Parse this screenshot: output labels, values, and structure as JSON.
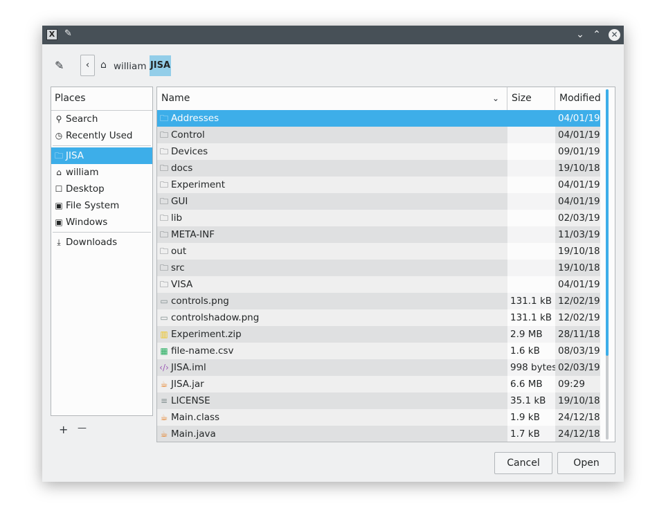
{
  "titlebar": {
    "app_icon": "kde-x-icon",
    "pin_icon": "pin-icon",
    "minimize_icon": "chevron-down-icon",
    "maximize_icon": "chevron-up-icon",
    "close_icon": "close-icon"
  },
  "nav": {
    "edit_icon": "pencil-icon",
    "back_icon": "chevron-left-icon",
    "home_icon": "home-icon",
    "crumbs": [
      "william",
      "JISA"
    ]
  },
  "places": {
    "header": "Places",
    "items": [
      {
        "label": "Search",
        "icon": "search-icon"
      },
      {
        "label": "Recently Used",
        "icon": "recent-icon"
      },
      {
        "label": "JISA",
        "icon": "folder-icon",
        "selected": true
      },
      {
        "label": "william",
        "icon": "home-icon"
      },
      {
        "label": "Desktop",
        "icon": "desktop-icon"
      },
      {
        "label": "File System",
        "icon": "drive-icon"
      },
      {
        "label": "Windows",
        "icon": "drive-icon"
      },
      {
        "label": "Downloads",
        "icon": "download-icon"
      }
    ],
    "add_label": "+",
    "remove_label": "—"
  },
  "files": {
    "columns": {
      "name": "Name",
      "size": "Size",
      "modified": "Modified"
    },
    "rows": [
      {
        "name": "Addresses",
        "size": "",
        "modified": "04/01/19",
        "icon": "folder-icon",
        "glyph": "🗀",
        "color": "#fcfcfc"
      },
      {
        "name": "Control",
        "size": "",
        "modified": "04/01/19",
        "icon": "folder-icon",
        "glyph": "🗀",
        "color": "#31363b"
      },
      {
        "name": "Devices",
        "size": "",
        "modified": "09/01/19",
        "icon": "folder-icon",
        "glyph": "🗀",
        "color": "#31363b"
      },
      {
        "name": "docs",
        "size": "",
        "modified": "19/10/18",
        "icon": "folder-icon",
        "glyph": "🗀",
        "color": "#31363b"
      },
      {
        "name": "Experiment",
        "size": "",
        "modified": "04/01/19",
        "icon": "folder-icon",
        "glyph": "🗀",
        "color": "#31363b"
      },
      {
        "name": "GUI",
        "size": "",
        "modified": "04/01/19",
        "icon": "folder-icon",
        "glyph": "🗀",
        "color": "#31363b"
      },
      {
        "name": "lib",
        "size": "",
        "modified": "02/03/19",
        "icon": "folder-icon",
        "glyph": "🗀",
        "color": "#31363b"
      },
      {
        "name": "META-INF",
        "size": "",
        "modified": "11/03/19",
        "icon": "folder-icon",
        "glyph": "🗀",
        "color": "#31363b"
      },
      {
        "name": "out",
        "size": "",
        "modified": "19/10/18",
        "icon": "folder-icon",
        "glyph": "🗀",
        "color": "#31363b"
      },
      {
        "name": "src",
        "size": "",
        "modified": "19/10/18",
        "icon": "folder-icon",
        "glyph": "🗀",
        "color": "#31363b"
      },
      {
        "name": "VISA",
        "size": "",
        "modified": "04/01/19",
        "icon": "folder-icon",
        "glyph": "🗀",
        "color": "#31363b"
      },
      {
        "name": "controls.png",
        "size": "131.1 kB",
        "modified": "12/02/19",
        "icon": "image-file-icon",
        "glyph": "▭",
        "color": "#7f8c8d"
      },
      {
        "name": "controlshadow.png",
        "size": "131.1 kB",
        "modified": "12/02/19",
        "icon": "image-file-icon",
        "glyph": "▭",
        "color": "#7f8c8d"
      },
      {
        "name": "Experiment.zip",
        "size": "2.9 MB",
        "modified": "28/11/18",
        "icon": "archive-icon",
        "glyph": "▥",
        "color": "#f0c419"
      },
      {
        "name": "file-name.csv",
        "size": "1.6 kB",
        "modified": "08/03/19",
        "icon": "spreadsheet-icon",
        "glyph": "▦",
        "color": "#27ae60"
      },
      {
        "name": "JISA.iml",
        "size": "998 bytes",
        "modified": "02/03/19",
        "icon": "code-file-icon",
        "glyph": "‹/›",
        "color": "#9b59b6"
      },
      {
        "name": "JISA.jar",
        "size": "6.6 MB",
        "modified": "09:29",
        "icon": "java-icon",
        "glyph": "☕",
        "color": "#e67e22"
      },
      {
        "name": "LICENSE",
        "size": "35.1 kB",
        "modified": "19/10/18",
        "icon": "text-file-icon",
        "glyph": "≡",
        "color": "#7f8c8d"
      },
      {
        "name": "Main.class",
        "size": "1.9 kB",
        "modified": "24/12/18",
        "icon": "java-icon",
        "glyph": "☕",
        "color": "#e67e22"
      },
      {
        "name": "Main.java",
        "size": "1.7 kB",
        "modified": "24/12/18",
        "icon": "java-icon",
        "glyph": "☕",
        "color": "#e67e22"
      }
    ],
    "scroll_position": 0.0,
    "scroll_visible_fraction": 0.76
  },
  "buttons": {
    "cancel": "Cancel",
    "open": "Open"
  },
  "colors": {
    "accent": "#3daee9",
    "crumb_highlight": "#93cee9",
    "titlebar": "#475057"
  }
}
